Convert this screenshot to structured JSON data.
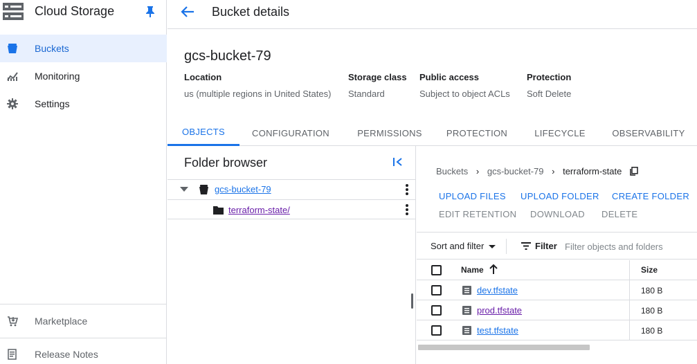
{
  "sidebar": {
    "title": "Cloud Storage",
    "items": [
      {
        "label": "Buckets",
        "icon": "bucket-icon"
      },
      {
        "label": "Monitoring",
        "icon": "monitoring-icon"
      },
      {
        "label": "Settings",
        "icon": "gear-icon"
      }
    ],
    "footer": [
      {
        "label": "Marketplace",
        "icon": "marketplace-icon"
      },
      {
        "label": "Release Notes",
        "icon": "release-notes-icon"
      }
    ]
  },
  "header": {
    "title": "Bucket details"
  },
  "bucket": {
    "name": "gcs-bucket-79",
    "info": [
      {
        "key": "Location",
        "value": "us (multiple regions in United States)"
      },
      {
        "key": "Storage class",
        "value": "Standard"
      },
      {
        "key": "Public access",
        "value": "Subject to object ACLs"
      },
      {
        "key": "Protection",
        "value": "Soft Delete"
      }
    ]
  },
  "tabs": [
    {
      "label": "OBJECTS",
      "active": true
    },
    {
      "label": "CONFIGURATION"
    },
    {
      "label": "PERMISSIONS"
    },
    {
      "label": "PROTECTION"
    },
    {
      "label": "LIFECYCLE"
    },
    {
      "label": "OBSERVABILITY"
    }
  ],
  "folder_browser": {
    "title": "Folder browser",
    "tree": [
      {
        "label": "gcs-bucket-79",
        "icon": "bucket-icon"
      },
      {
        "label": "terraform-state/",
        "icon": "folder-icon"
      }
    ]
  },
  "objects": {
    "breadcrumbs": [
      "Buckets",
      "gcs-bucket-79",
      "terraform-state"
    ],
    "actions_primary": [
      "UPLOAD FILES",
      "UPLOAD FOLDER",
      "CREATE FOLDER"
    ],
    "actions_disabled": [
      "EDIT RETENTION",
      "DOWNLOAD",
      "DELETE"
    ],
    "sort_label": "Sort and filter",
    "filter_label": "Filter",
    "filter_placeholder": "Filter objects and folders",
    "columns": [
      "Name",
      "Size"
    ],
    "rows": [
      {
        "name": "dev.tfstate",
        "size": "180 B"
      },
      {
        "name": "prod.tfstate",
        "size": "180 B"
      },
      {
        "name": "test.tfstate",
        "size": "180 B"
      }
    ]
  },
  "colors": {
    "accent": "#1a73e8",
    "active_bg": "#e8f0fe",
    "visited": "#681da8",
    "divider": "#dadce0"
  }
}
